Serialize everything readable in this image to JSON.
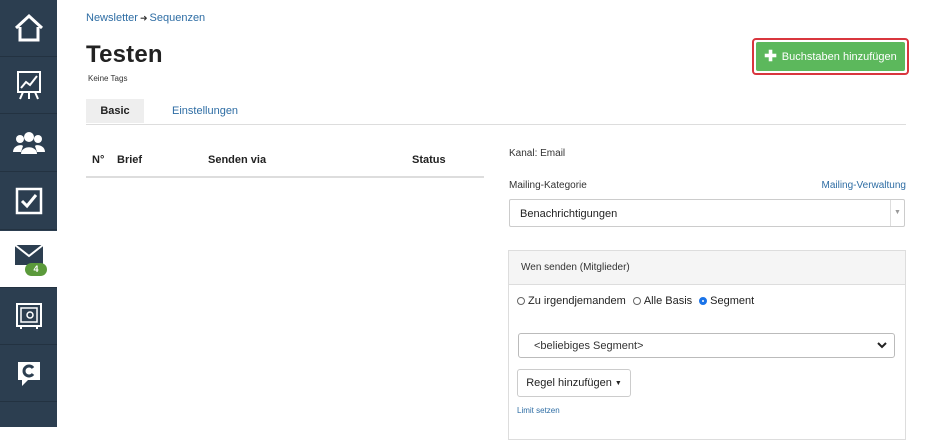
{
  "sidebar": {
    "items": [
      {
        "icon": "home-icon"
      },
      {
        "icon": "chart-icon"
      },
      {
        "icon": "users-icon"
      },
      {
        "icon": "checkbox-icon"
      },
      {
        "icon": "mail-icon",
        "badge": "4",
        "active": true
      },
      {
        "icon": "safe-icon"
      },
      {
        "icon": "c-logo-icon"
      }
    ]
  },
  "breadcrumb": {
    "parent": "Newsletter",
    "separator": "➜",
    "current": "Sequenzen"
  },
  "page": {
    "title": "Testen",
    "tags": "Keine Tags"
  },
  "toolbar": {
    "add_label": "Buchstaben hinzufügen",
    "add_icon": "plus-icon"
  },
  "tabs": [
    {
      "label": "Basic"
    },
    {
      "label": "Einstellungen"
    }
  ],
  "table": {
    "columns": [
      "N°",
      "Brief",
      "Senden via",
      "Status"
    ]
  },
  "channel": {
    "text": "Kanal: Email"
  },
  "mailing": {
    "label": "Mailing-Kategorie",
    "link": "Mailing-Verwaltung",
    "selected": "Benachrichtigungen"
  },
  "recipients": {
    "title": "Wen senden (Mitglieder)",
    "options": [
      {
        "label": "Zu irgendjemandem",
        "checked": false
      },
      {
        "label": "Alle Basis",
        "checked": false
      },
      {
        "label": "Segment",
        "checked": true
      }
    ],
    "segment_placeholder": "<beliebiges Segment>",
    "add_rule": "Regel hinzufügen",
    "limit": "Limit setzen"
  },
  "colors": {
    "sidebar": "#2c3e50",
    "accent_green": "#5cb85c",
    "highlight": "#d9363e",
    "link": "#2e6da4"
  }
}
